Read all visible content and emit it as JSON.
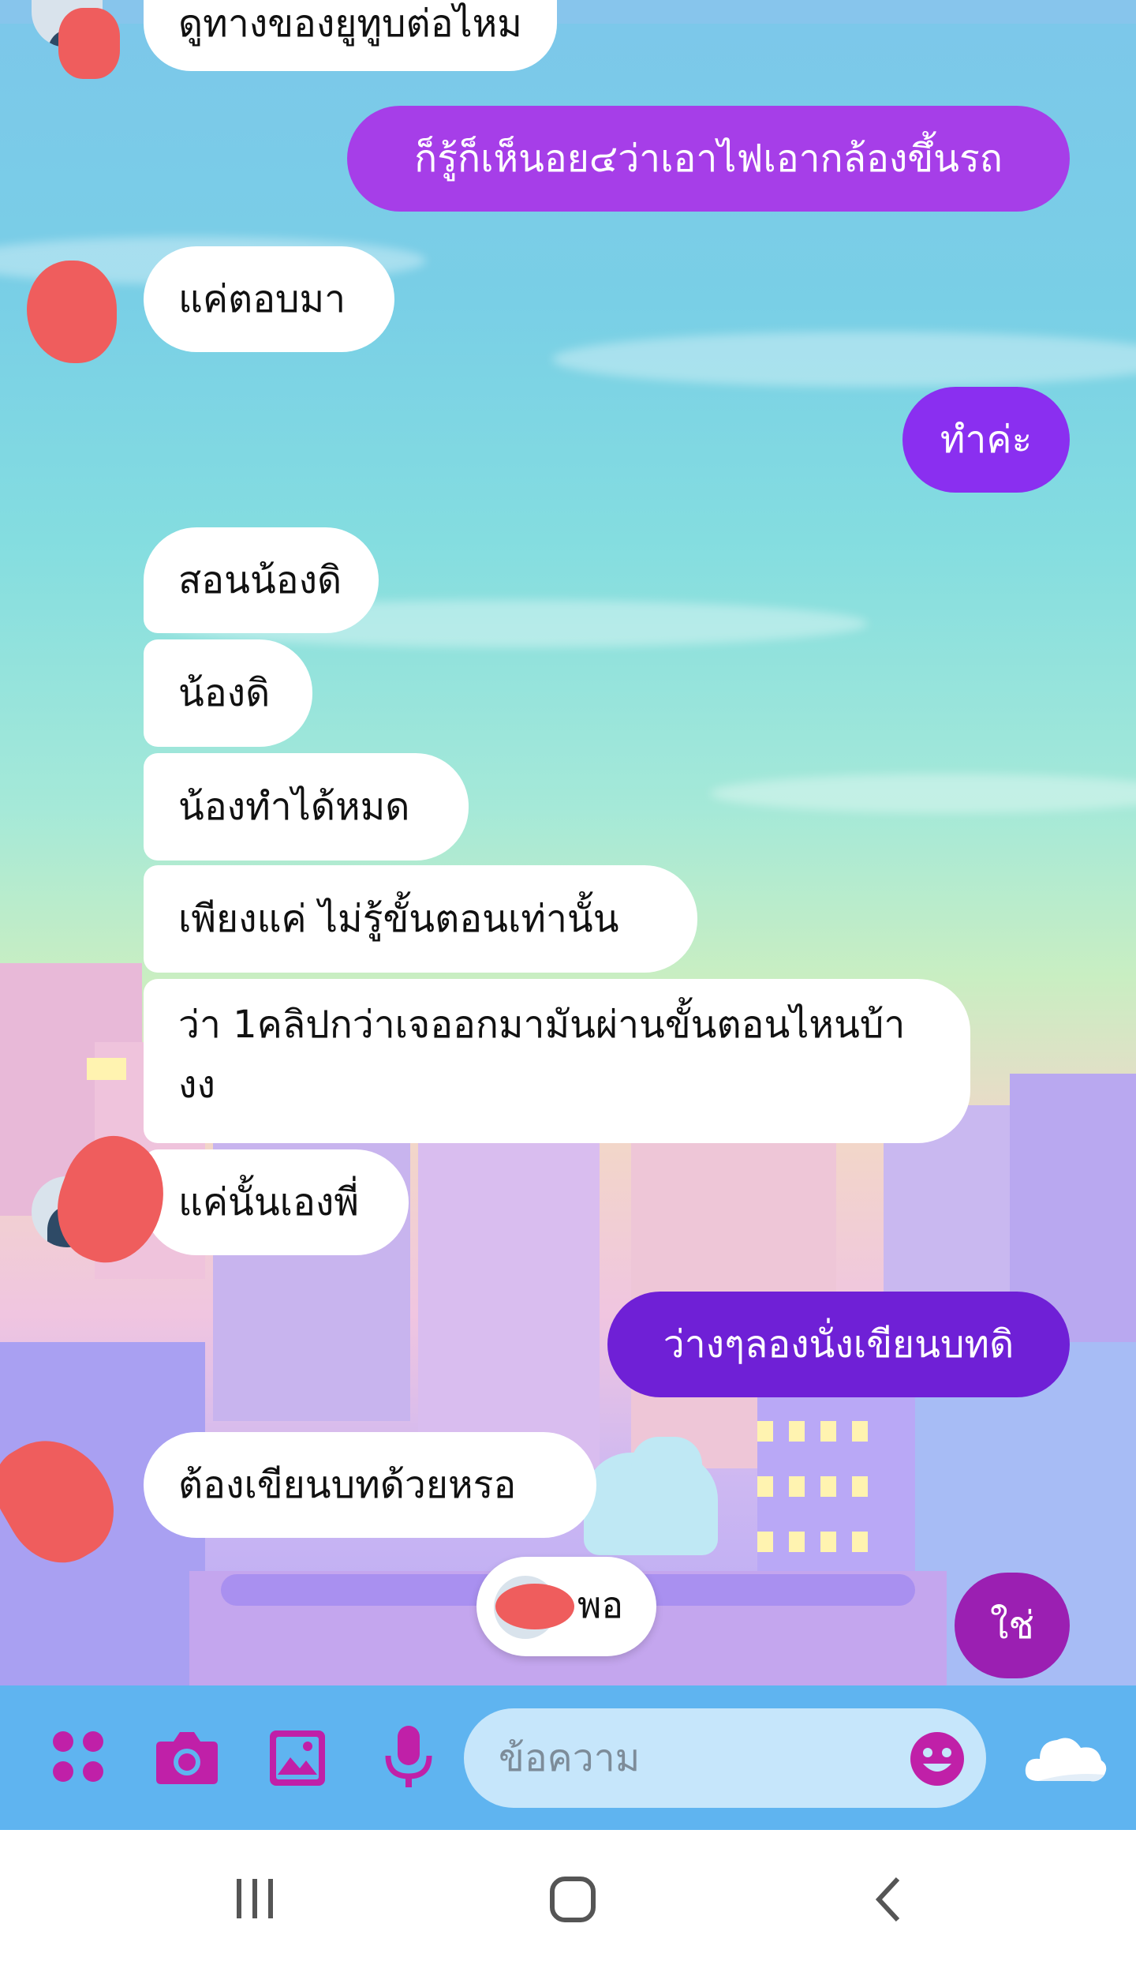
{
  "colors": {
    "sent_purple_light": "#a63ee8",
    "sent_purple": "#8a2ff0",
    "sent_purple_dark": "#6f20d6",
    "sent_magenta": "#9b1fb2",
    "icon_magenta": "#c020a8",
    "received_bg": "#ffffff"
  },
  "messages": [
    {
      "id": "m0",
      "side": "received",
      "text": "ดูทางของยูทูบต่อไหม"
    },
    {
      "id": "m1",
      "side": "sent",
      "text": "ก็รู้ก็เห็นอย๔ว่าเอาไฟเอากล้องขึ้นรถ"
    },
    {
      "id": "m2",
      "side": "received",
      "text": "แค่ตอบมา"
    },
    {
      "id": "m3",
      "side": "sent",
      "text": "ทำค่ะ"
    },
    {
      "id": "m4",
      "side": "received",
      "text": "สอนน้องดิ"
    },
    {
      "id": "m5",
      "side": "received",
      "text": "น้องดิ"
    },
    {
      "id": "m6",
      "side": "received",
      "text": "น้องทำได้หมด"
    },
    {
      "id": "m7",
      "side": "received",
      "text": "เพียงแค่ ไม่รู้ขั้นตอนเท่านั้น"
    },
    {
      "id": "m8",
      "side": "received",
      "text": "ว่า 1คลิปกว่าเจออกมามันผ่านขั้นตอนไหนบ้างง"
    },
    {
      "id": "m9",
      "side": "received",
      "text": "แค่นั้นเองพี่"
    },
    {
      "id": "m10",
      "side": "sent",
      "text": "ว่างๆลองนั่งเขียนบทดิ"
    },
    {
      "id": "m11",
      "side": "received",
      "text": "ต้องเขียนบทด้วยหรอ"
    },
    {
      "id": "m12",
      "side": "sent",
      "text": "ใช่"
    }
  ],
  "reply_chip": {
    "text": "พอ"
  },
  "composer": {
    "placeholder": "ข้อความ",
    "icons": [
      "apps-icon",
      "camera-icon",
      "gallery-icon",
      "microphone-icon",
      "emoji-icon",
      "cloud-theme-icon"
    ]
  },
  "system_nav": {
    "icons": [
      "recent-apps-icon",
      "home-icon",
      "back-icon"
    ]
  }
}
